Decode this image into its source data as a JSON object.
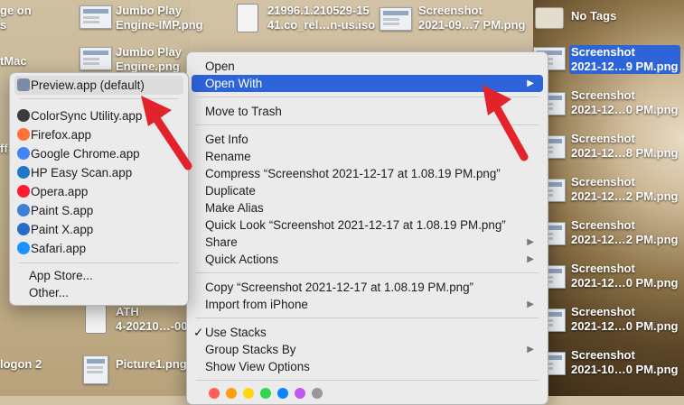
{
  "desktop": {
    "left_labels": [
      {
        "text": "ge on\ns",
        "icon": "drive-icon"
      },
      {
        "text": "tMac",
        "icon": "drive-icon"
      },
      {
        "text": "ff",
        "icon": "file-icon"
      },
      {
        "text": "logon 2",
        "icon": "file-icon"
      }
    ],
    "items": [
      {
        "label": "Jumbo Play\nEngine-IMP.png"
      },
      {
        "label": "Jumbo Play\nEngine.png"
      },
      {
        "label": "21996.1.210529-15\n41.co_rel…n-us.iso"
      },
      {
        "label": "Screenshot\n2021-09…7 PM.png"
      },
      {
        "label": "No Tags"
      },
      {
        "label": "ATH\n4-20210…-00"
      },
      {
        "label": "Picture1.png"
      }
    ],
    "right_column": [
      {
        "label": "Screenshot\n2021-12…9 PM.png",
        "selected": true
      },
      {
        "label": "Screenshot\n2021-12…0 PM.png",
        "selected": false
      },
      {
        "label": "Screenshot\n2021-12…8 PM.png",
        "selected": false
      },
      {
        "label": "Screenshot\n2021-12…2 PM.png",
        "selected": false
      },
      {
        "label": "Screenshot\n2021-12…2 PM.png",
        "selected": false
      },
      {
        "label": "Screenshot\n2021-12…0 PM.png",
        "selected": false
      },
      {
        "label": "Screenshot\n2021-12…0 PM.png",
        "selected": false
      },
      {
        "label": "Screenshot\n2021-10…0 PM.png",
        "selected": false
      }
    ]
  },
  "context_menu": {
    "items": [
      {
        "label": "Open",
        "submenu": false
      },
      {
        "label": "Open With",
        "submenu": true,
        "highlighted": true
      },
      {
        "label": "Move to Trash",
        "submenu": false
      },
      {
        "label": "Get Info",
        "submenu": false
      },
      {
        "label": "Rename",
        "submenu": false
      },
      {
        "label": "Compress “Screenshot 2021-12-17 at 1.08.19 PM.png”",
        "submenu": false
      },
      {
        "label": "Duplicate",
        "submenu": false
      },
      {
        "label": "Make Alias",
        "submenu": false
      },
      {
        "label": "Quick Look “Screenshot 2021-12-17 at 1.08.19 PM.png”",
        "submenu": false
      },
      {
        "label": "Share",
        "submenu": true
      },
      {
        "label": "Quick Actions",
        "submenu": true
      },
      {
        "label": "Copy “Screenshot 2021-12-17 at 1.08.19 PM.png”",
        "submenu": false
      },
      {
        "label": "Import from iPhone",
        "submenu": true
      },
      {
        "label": "Use Stacks",
        "submenu": false,
        "checked": true
      },
      {
        "label": "Group Stacks By",
        "submenu": true
      },
      {
        "label": "Show View Options",
        "submenu": false
      }
    ],
    "check_mark": "✓",
    "submenu_chevron": "▶",
    "tag_colors": [
      "#ff5f57",
      "#ff9f0a",
      "#ffd60a",
      "#32d74b",
      "#0a84ff",
      "#bf5af2",
      "#98989d"
    ]
  },
  "open_with_menu": {
    "default_app": "Preview.app (default)",
    "apps": [
      {
        "label": "ColorSync Utility.app",
        "icon": "colorsync-icon",
        "color": "#3b3b3b"
      },
      {
        "label": "Firefox.app",
        "icon": "firefox-icon",
        "color": "#ff7139"
      },
      {
        "label": "Google Chrome.app",
        "icon": "chrome-icon",
        "color": "#4285f4"
      },
      {
        "label": "HP Easy Scan.app",
        "icon": "hp-scan-icon",
        "color": "#1f78c8"
      },
      {
        "label": "Opera.app",
        "icon": "opera-icon",
        "color": "#ff1b2d"
      },
      {
        "label": "Paint S.app",
        "icon": "paint-s-icon",
        "color": "#3d7fd6"
      },
      {
        "label": "Paint X.app",
        "icon": "paint-x-icon",
        "color": "#2a6bc7"
      },
      {
        "label": "Safari.app",
        "icon": "safari-icon",
        "color": "#1e90ff"
      }
    ],
    "app_store": "App Store...",
    "other": "Other..."
  },
  "colors": {
    "highlight": "#2e64d9",
    "arrow": "#e3232c"
  }
}
